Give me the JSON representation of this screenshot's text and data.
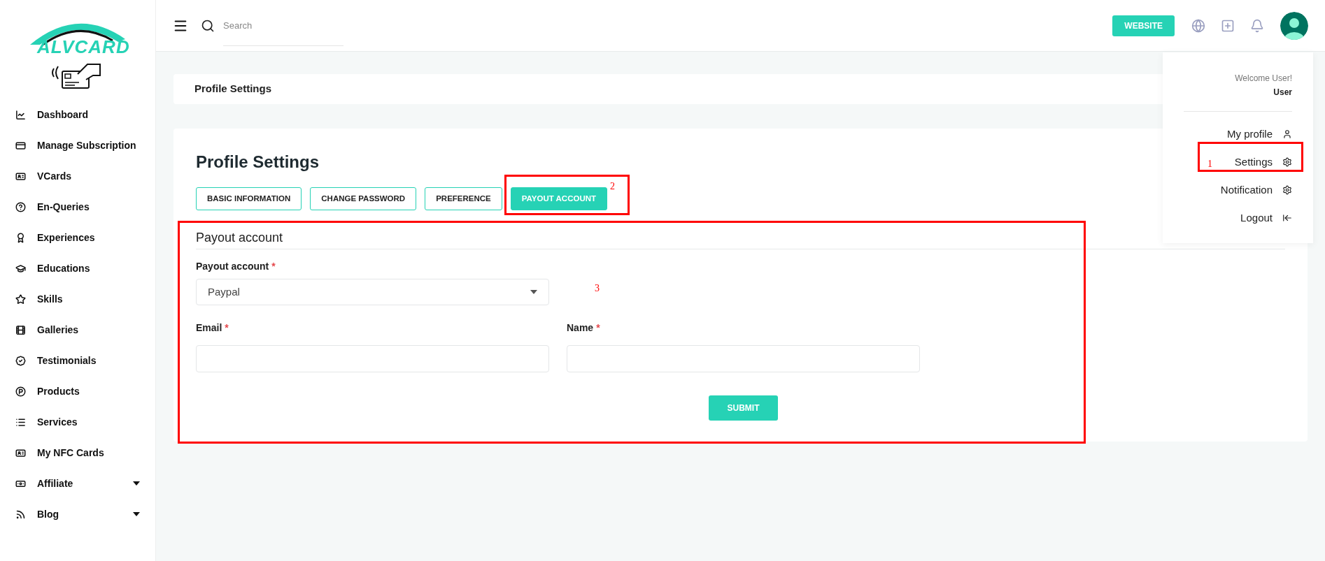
{
  "logo": {
    "text": "ALVCARD"
  },
  "sidebar": {
    "items": [
      {
        "label": "Dashboard",
        "expandable": false
      },
      {
        "label": "Manage Subscription",
        "expandable": false
      },
      {
        "label": "VCards",
        "expandable": false
      },
      {
        "label": "En-Queries",
        "expandable": false
      },
      {
        "label": "Experiences",
        "expandable": false
      },
      {
        "label": "Educations",
        "expandable": false
      },
      {
        "label": "Skills",
        "expandable": false
      },
      {
        "label": "Galleries",
        "expandable": false
      },
      {
        "label": "Testimonials",
        "expandable": false
      },
      {
        "label": "Products",
        "expandable": false
      },
      {
        "label": "Services",
        "expandable": false
      },
      {
        "label": "My NFC Cards",
        "expandable": false
      },
      {
        "label": "Affiliate",
        "expandable": true
      },
      {
        "label": "Blog",
        "expandable": true
      }
    ]
  },
  "topbar": {
    "search": {
      "placeholder": "Search"
    },
    "website_button": "WEBSITE"
  },
  "breadcrumb": {
    "title": "Profile Settings"
  },
  "card": {
    "title": "Profile Settings",
    "tabs": [
      {
        "label": "BASIC INFORMATION",
        "selected": false
      },
      {
        "label": "CHANGE PASSWORD",
        "selected": false
      },
      {
        "label": "PREFERENCE",
        "selected": false
      },
      {
        "label": "PAYOUT ACCOUNT",
        "selected": true
      }
    ],
    "section_title": "Payout account",
    "fields": [
      {
        "kind": "select",
        "label": "Payout account",
        "required_mark": "*",
        "value": "Paypal"
      },
      {
        "kind": "text",
        "label": "Email",
        "required_mark": "*"
      },
      {
        "kind": "text",
        "label": "Name",
        "required_mark": "*"
      }
    ],
    "submit": "SUBMIT"
  },
  "user_menu": {
    "welcome": "Welcome User!",
    "name": "User",
    "items": [
      {
        "label": "My profile"
      },
      {
        "label": "Settings"
      },
      {
        "label": "Notification"
      },
      {
        "label": "Logout"
      }
    ]
  },
  "annotations": [
    {
      "label": "1"
    },
    {
      "label": "2"
    },
    {
      "label": "3"
    }
  ]
}
